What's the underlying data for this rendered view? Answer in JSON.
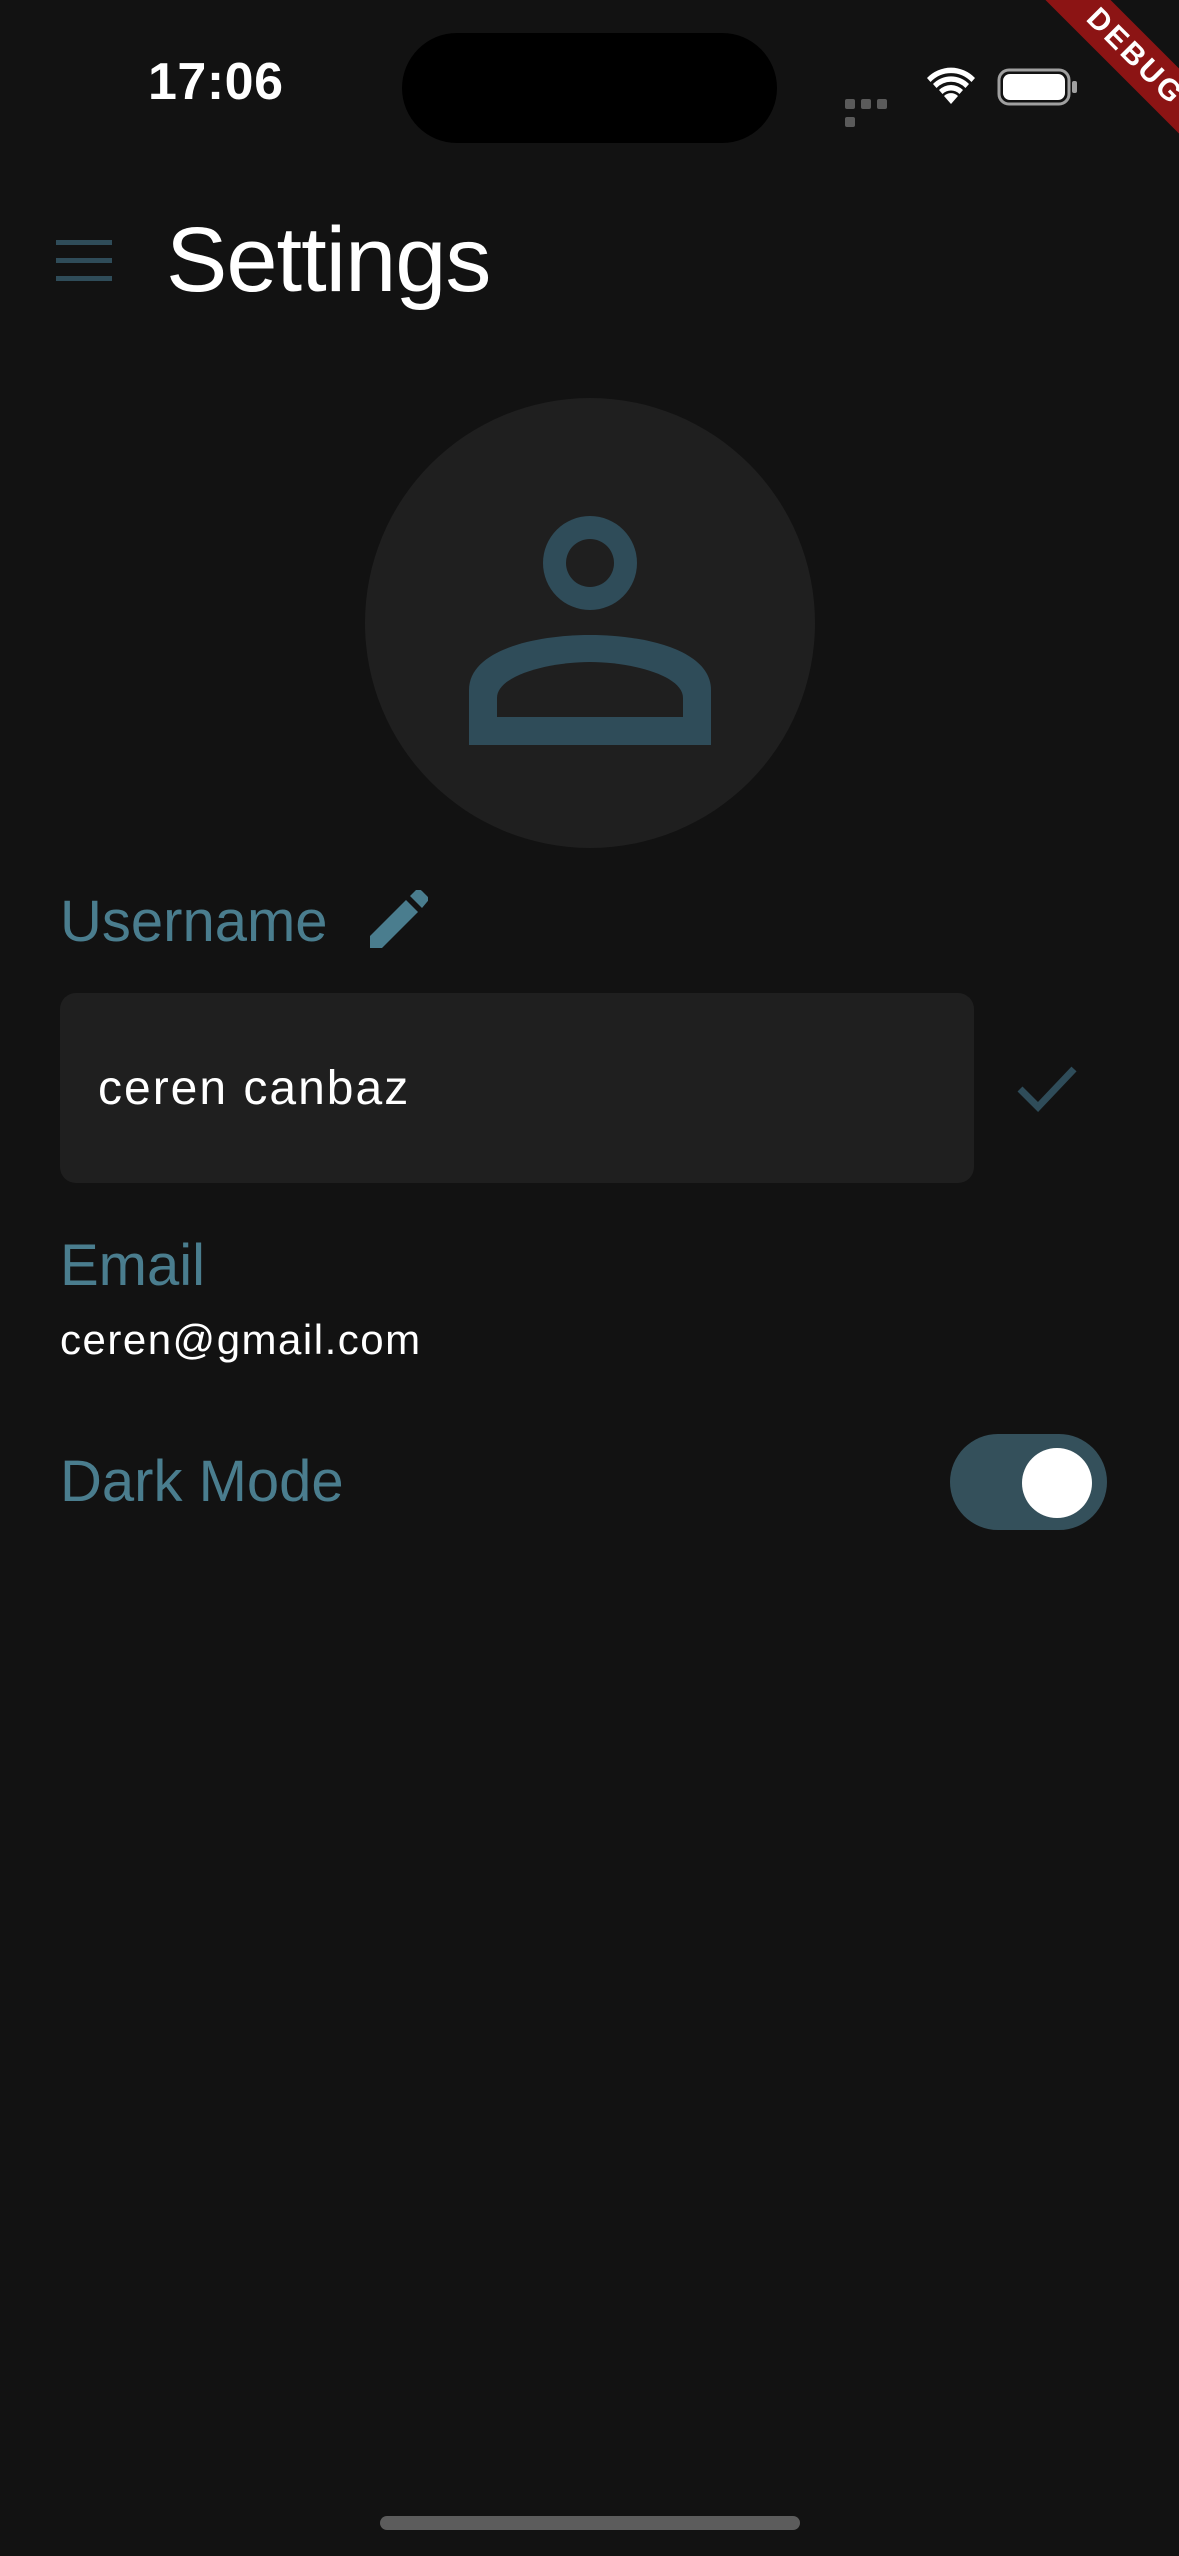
{
  "status_bar": {
    "time": "17:06"
  },
  "debug_banner": {
    "label": "DEBUG",
    "color": "#8c1414"
  },
  "app_bar": {
    "menu_icon": "hamburger-menu-icon",
    "title": "Settings"
  },
  "avatar": {
    "icon": "person-outline-icon"
  },
  "username": {
    "label": "Username",
    "edit_icon": "pencil-icon",
    "value": "ceren canbaz",
    "confirm_icon": "check-icon"
  },
  "email": {
    "label": "Email",
    "value": "ceren@gmail.com"
  },
  "dark_mode": {
    "label": "Dark Mode",
    "enabled": true
  },
  "colors": {
    "background": "#121212",
    "surface": "#1f1f1f",
    "accent": "#4a7d8e",
    "icon_accent": "#2f4c59",
    "toggle_track": "#34505b"
  }
}
